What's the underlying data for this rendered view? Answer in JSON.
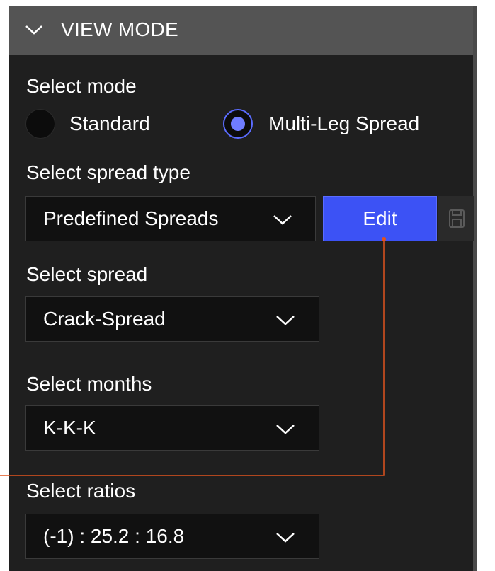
{
  "header": {
    "title": "VIEW MODE",
    "icon": "chevron-down-icon"
  },
  "mode": {
    "label": "Select mode",
    "options": [
      {
        "label": "Standard",
        "selected": false
      },
      {
        "label": "Multi-Leg Spread",
        "selected": true
      }
    ]
  },
  "spread_type": {
    "label": "Select spread type",
    "value": "Predefined Spreads",
    "edit_label": "Edit",
    "save_icon": "save-icon"
  },
  "spread": {
    "label": "Select spread",
    "value": "Crack-Spread"
  },
  "months": {
    "label": "Select months",
    "value": "K-K-K"
  },
  "ratios": {
    "label": "Select ratios",
    "value": "(-1) : 25.2 : 16.8"
  },
  "colors": {
    "accent": "#3c52f5",
    "radio_selected": "#6f7dff",
    "panel_bg": "#1f1f1f",
    "header_bg": "#545454",
    "annotation": "#e0531f"
  }
}
